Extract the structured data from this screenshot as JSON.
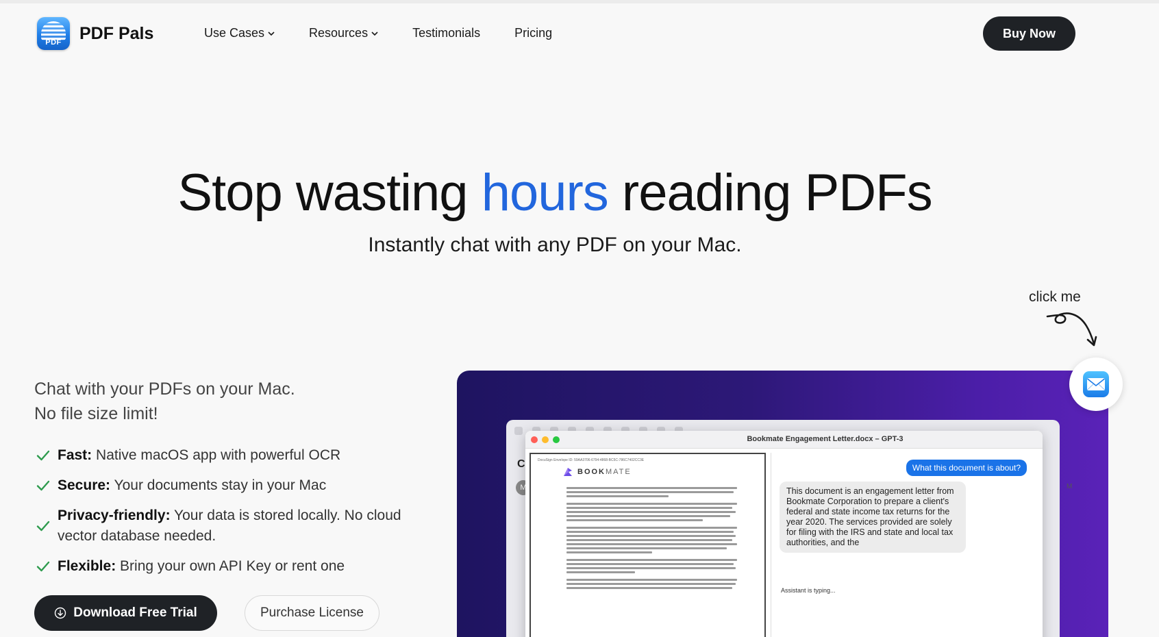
{
  "header": {
    "brand": "PDF Pals",
    "logo_text": "PDF",
    "nav": [
      {
        "label": "Use Cases",
        "has_dropdown": true
      },
      {
        "label": "Resources",
        "has_dropdown": true
      },
      {
        "label": "Testimonials",
        "has_dropdown": false
      },
      {
        "label": "Pricing",
        "has_dropdown": false
      }
    ],
    "buy_label": "Buy Now"
  },
  "hero": {
    "title_before": "Stop wasting ",
    "title_highlight": "hours",
    "title_after": " reading PDFs",
    "subtitle": "Instantly chat with any PDF on your Mac.",
    "highlight_color": "#2266dd"
  },
  "lead": {
    "line1": "Chat with your PDFs on your Mac.",
    "line2": "No file size limit!"
  },
  "features": [
    {
      "title": "Fast:",
      "text": " Native macOS app with powerful OCR"
    },
    {
      "title": "Secure:",
      "text": " Your documents stay in your Mac"
    },
    {
      "title": "Privacy-friendly:",
      "text": " Your data is stored locally. No cloud vector database needed."
    },
    {
      "title": "Flexible:",
      "text": " Bring your own API Key or rent one"
    }
  ],
  "cta": {
    "trial_label": "Download Free Trial",
    "license_label": "Purchase License"
  },
  "callout": {
    "click_me": "click me",
    "icon": "mail-icon"
  },
  "demo": {
    "window_title": "Bookmate Engagement Letter.docx – GPT-3",
    "side_initial": "C",
    "avatar_initial": "M",
    "envelope_id": "DocuSign Envelope ID: 59AA3706-6794-4868-BC5C-786C7402CC3E",
    "doc_brand_bold": "BOOK",
    "doc_brand_light": "MATE",
    "question": "What this document is about?",
    "answer": "This document is an engagement letter from Bookmate Corporation to prepare a client's federal and state income tax returns for the year 2020. The services provided are solely for filing with the IRS and state and local tax authorities, and the",
    "typing": "Assistant is typing...",
    "side_right": "M"
  },
  "colors": {
    "dark_button": "#1f2226",
    "check_green": "#2e9b4e",
    "chat_blue": "#1a73e8"
  }
}
